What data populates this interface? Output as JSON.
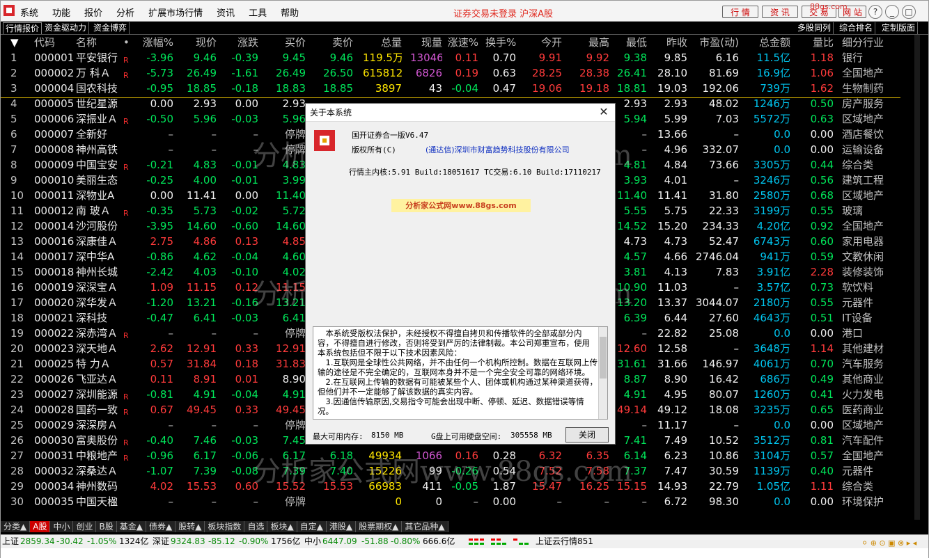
{
  "window": {
    "menus": [
      "系统",
      "功能",
      "报价",
      "分析",
      "扩展市场行情",
      "资讯",
      "工具",
      "帮助"
    ],
    "center_title": "证券交易未登录  沪深A股",
    "buttons": [
      "行 情",
      "资 讯",
      "交 易",
      "网 站"
    ],
    "url_fragment": "88gs.com",
    "controls": [
      "?",
      "_",
      "□",
      "✕"
    ]
  },
  "subtabs": {
    "left": [
      "行情报价",
      "资金驱动力",
      "资金博弈"
    ],
    "right": [
      "多股同列",
      "综合排名",
      "定制版面"
    ]
  },
  "table": {
    "headers": [
      "代码",
      "名称",
      "•",
      "涨幅%",
      "现价",
      "涨跌",
      "买价",
      "卖价",
      "总量",
      "现量",
      "涨速%",
      "换手%",
      "今开",
      "最高",
      "最低",
      "昨收",
      "市盈(动)",
      "总金额",
      "量比",
      "细分行业"
    ],
    "rows": [
      {
        "no": "1",
        "code": "000001",
        "name": "平安银行",
        "mark": "R",
        "chg_pct": "-3.96",
        "price": "9.46",
        "chg": "-0.39",
        "bid": "9.45",
        "ask": "9.46",
        "vol": "119.5万",
        "cur_vol": "13046",
        "speed": "0.11",
        "turnover": "0.70",
        "open": "9.91",
        "high": "9.92",
        "low": "9.38",
        "prev": "9.85",
        "pe": "6.16",
        "amount": "11.5亿",
        "vol_ratio": "1.18",
        "industry": "银行"
      },
      {
        "no": "2",
        "code": "000002",
        "name": "万 科Ａ",
        "mark": "R",
        "chg_pct": "-5.73",
        "price": "26.49",
        "chg": "-1.61",
        "bid": "26.49",
        "ask": "26.50",
        "vol": "615812",
        "cur_vol": "6826",
        "speed": "0.19",
        "turnover": "0.63",
        "open": "28.25",
        "high": "28.38",
        "low": "26.41",
        "prev": "28.10",
        "pe": "81.69",
        "amount": "16.9亿",
        "vol_ratio": "1.06",
        "industry": "全国地产"
      },
      {
        "no": "3",
        "code": "000004",
        "name": "国农科技",
        "mark": "",
        "chg_pct": "-0.95",
        "price": "18.85",
        "chg": "-0.18",
        "bid": "18.83",
        "ask": "18.85",
        "vol": "3897",
        "cur_vol": "43",
        "speed": "-0.04",
        "turnover": "0.47",
        "open": "19.06",
        "high": "19.18",
        "low": "18.81",
        "prev": "19.03",
        "pe": "192.06",
        "amount": "739万",
        "vol_ratio": "1.62",
        "industry": "生物制药"
      },
      {
        "no": "4",
        "code": "000005",
        "name": "世纪星源",
        "mark": "",
        "chg_pct": "0.00",
        "price": "2.93",
        "chg": "0.00",
        "bid": "2.93",
        "ask": "",
        "vol": "",
        "cur_vol": "",
        "speed": "",
        "turnover": "",
        "open": "",
        "high": "",
        "low": "2.93",
        "prev": "2.93",
        "pe": "48.02",
        "amount": "1246万",
        "vol_ratio": "0.50",
        "industry": "房产服务"
      },
      {
        "no": "5",
        "code": "000006",
        "name": "深振业Ａ",
        "mark": "R",
        "chg_pct": "-0.50",
        "price": "5.96",
        "chg": "-0.03",
        "bid": "5.96",
        "ask": "",
        "vol": "",
        "cur_vol": "",
        "speed": "",
        "turnover": "",
        "open": "",
        "high": "",
        "low": "5.94",
        "prev": "5.99",
        "pe": "7.03",
        "amount": "5572万",
        "vol_ratio": "0.63",
        "industry": "区域地产"
      },
      {
        "no": "6",
        "code": "000007",
        "name": "全新好",
        "mark": "",
        "chg_pct": "–",
        "price": "–",
        "chg": "–",
        "bid": "停牌",
        "ask": "",
        "vol": "",
        "cur_vol": "",
        "speed": "",
        "turnover": "",
        "open": "",
        "high": "",
        "low": "–",
        "prev": "13.66",
        "pe": "–",
        "amount": "0.0",
        "vol_ratio": "0.00",
        "industry": "酒店餐饮"
      },
      {
        "no": "7",
        "code": "000008",
        "name": "神州高铁",
        "mark": "",
        "chg_pct": "–",
        "price": "–",
        "chg": "–",
        "bid": "停牌",
        "ask": "",
        "vol": "",
        "cur_vol": "",
        "speed": "",
        "turnover": "",
        "open": "",
        "high": "",
        "low": "–",
        "prev": "4.96",
        "pe": "332.07",
        "amount": "0.0",
        "vol_ratio": "0.00",
        "industry": "运输设备"
      },
      {
        "no": "8",
        "code": "000009",
        "name": "中国宝安",
        "mark": "R",
        "chg_pct": "-0.21",
        "price": "4.83",
        "chg": "-0.01",
        "bid": "4.83",
        "ask": "",
        "vol": "",
        "cur_vol": "",
        "speed": "",
        "turnover": "",
        "open": "",
        "high": "",
        "low": "4.81",
        "prev": "4.84",
        "pe": "73.66",
        "amount": "3305万",
        "vol_ratio": "0.44",
        "industry": "综合类"
      },
      {
        "no": "9",
        "code": "000010",
        "name": "美丽生态",
        "mark": "",
        "chg_pct": "-0.25",
        "price": "4.00",
        "chg": "-0.01",
        "bid": "3.99",
        "ask": "",
        "vol": "",
        "cur_vol": "",
        "speed": "",
        "turnover": "",
        "open": "",
        "high": "",
        "low": "3.93",
        "prev": "4.01",
        "pe": "–",
        "amount": "3246万",
        "vol_ratio": "0.56",
        "industry": "建筑工程"
      },
      {
        "no": "10",
        "code": "000011",
        "name": "深物业A",
        "mark": "",
        "chg_pct": "0.00",
        "price": "11.41",
        "chg": "0.00",
        "bid": "11.40",
        "ask": "",
        "vol": "",
        "cur_vol": "",
        "speed": "",
        "turnover": "",
        "open": "",
        "high": "",
        "low": "11.40",
        "prev": "11.41",
        "pe": "31.80",
        "amount": "2580万",
        "vol_ratio": "0.68",
        "industry": "区域地产"
      },
      {
        "no": "11",
        "code": "000012",
        "name": "南 玻Ａ",
        "mark": "R",
        "chg_pct": "-0.35",
        "price": "5.73",
        "chg": "-0.02",
        "bid": "5.72",
        "ask": "",
        "vol": "",
        "cur_vol": "",
        "speed": "",
        "turnover": "",
        "open": "",
        "high": "",
        "low": "5.55",
        "prev": "5.75",
        "pe": "22.33",
        "amount": "3199万",
        "vol_ratio": "0.55",
        "industry": "玻璃"
      },
      {
        "no": "12",
        "code": "000014",
        "name": "沙河股份",
        "mark": "",
        "chg_pct": "-3.95",
        "price": "14.60",
        "chg": "-0.60",
        "bid": "14.60",
        "ask": "",
        "vol": "",
        "cur_vol": "",
        "speed": "",
        "turnover": "",
        "open": "",
        "high": "",
        "low": "14.52",
        "prev": "15.20",
        "pe": "234.33",
        "amount": "4.20亿",
        "vol_ratio": "0.92",
        "industry": "全国地产"
      },
      {
        "no": "13",
        "code": "000016",
        "name": "深康佳Ａ",
        "mark": "",
        "chg_pct": "2.75",
        "price": "4.86",
        "chg": "0.13",
        "bid": "4.85",
        "ask": "",
        "vol": "",
        "cur_vol": "",
        "speed": "",
        "turnover": "",
        "open": "",
        "high": "",
        "low": "4.73",
        "prev": "4.73",
        "pe": "52.47",
        "amount": "6743万",
        "vol_ratio": "0.60",
        "industry": "家用电器"
      },
      {
        "no": "14",
        "code": "000017",
        "name": "深中华A",
        "mark": "",
        "chg_pct": "-0.86",
        "price": "4.62",
        "chg": "-0.04",
        "bid": "4.60",
        "ask": "",
        "vol": "",
        "cur_vol": "",
        "speed": "",
        "turnover": "",
        "open": "",
        "high": "",
        "low": "4.57",
        "prev": "4.66",
        "pe": "2746.04",
        "amount": "941万",
        "vol_ratio": "0.59",
        "industry": "文教休闲"
      },
      {
        "no": "15",
        "code": "000018",
        "name": "神州长城",
        "mark": "",
        "chg_pct": "-2.42",
        "price": "4.03",
        "chg": "-0.10",
        "bid": "4.02",
        "ask": "",
        "vol": "",
        "cur_vol": "",
        "speed": "",
        "turnover": "",
        "open": "",
        "high": "",
        "low": "3.81",
        "prev": "4.13",
        "pe": "7.83",
        "amount": "3.91亿",
        "vol_ratio": "2.28",
        "industry": "装修装饰"
      },
      {
        "no": "16",
        "code": "000019",
        "name": "深深宝Ａ",
        "mark": "",
        "chg_pct": "1.09",
        "price": "11.15",
        "chg": "0.12",
        "bid": "11.15",
        "ask": "",
        "vol": "",
        "cur_vol": "",
        "speed": "",
        "turnover": "",
        "open": "",
        "high": "",
        "low": "10.90",
        "prev": "11.03",
        "pe": "–",
        "amount": "3.57亿",
        "vol_ratio": "0.73",
        "industry": "软饮料"
      },
      {
        "no": "17",
        "code": "000020",
        "name": "深华发Ａ",
        "mark": "",
        "chg_pct": "-1.20",
        "price": "13.21",
        "chg": "-0.16",
        "bid": "13.21",
        "ask": "",
        "vol": "",
        "cur_vol": "",
        "speed": "",
        "turnover": "",
        "open": "",
        "high": "",
        "low": "13.20",
        "prev": "13.37",
        "pe": "3044.07",
        "amount": "2180万",
        "vol_ratio": "0.55",
        "industry": "元器件"
      },
      {
        "no": "18",
        "code": "000021",
        "name": "深科技",
        "mark": "",
        "chg_pct": "-0.47",
        "price": "6.41",
        "chg": "-0.03",
        "bid": "6.41",
        "ask": "",
        "vol": "",
        "cur_vol": "",
        "speed": "",
        "turnover": "",
        "open": "",
        "high": "",
        "low": "6.39",
        "prev": "6.44",
        "pe": "27.60",
        "amount": "4643万",
        "vol_ratio": "0.51",
        "industry": "IT设备"
      },
      {
        "no": "19",
        "code": "000022",
        "name": "深赤湾Ａ",
        "mark": "R",
        "chg_pct": "–",
        "price": "–",
        "chg": "–",
        "bid": "停牌",
        "ask": "",
        "vol": "",
        "cur_vol": "",
        "speed": "",
        "turnover": "",
        "open": "",
        "high": "",
        "low": "–",
        "prev": "22.82",
        "pe": "25.08",
        "amount": "0.0",
        "vol_ratio": "0.00",
        "industry": "港口"
      },
      {
        "no": "20",
        "code": "000023",
        "name": "深天地Ａ",
        "mark": "",
        "chg_pct": "2.62",
        "price": "12.91",
        "chg": "0.33",
        "bid": "12.91",
        "ask": "",
        "vol": "",
        "cur_vol": "",
        "speed": "",
        "turnover": "",
        "open": "",
        "high": "",
        "low": "12.60",
        "prev": "12.58",
        "pe": "–",
        "amount": "3648万",
        "vol_ratio": "1.14",
        "industry": "其他建材"
      },
      {
        "no": "21",
        "code": "000025",
        "name": "特 力Ａ",
        "mark": "",
        "chg_pct": "0.57",
        "price": "31.84",
        "chg": "0.18",
        "bid": "31.83",
        "ask": "",
        "vol": "",
        "cur_vol": "",
        "speed": "",
        "turnover": "",
        "open": "",
        "high": "",
        "low": "31.61",
        "prev": "31.66",
        "pe": "146.97",
        "amount": "4061万",
        "vol_ratio": "0.70",
        "industry": "汽车服务"
      },
      {
        "no": "22",
        "code": "000026",
        "name": "飞亚达Ａ",
        "mark": "",
        "chg_pct": "0.11",
        "price": "8.91",
        "chg": "0.01",
        "bid": "8.90",
        "ask": "",
        "vol": "",
        "cur_vol": "",
        "speed": "",
        "turnover": "",
        "open": "",
        "high": "",
        "low": "8.87",
        "prev": "8.90",
        "pe": "16.42",
        "amount": "686万",
        "vol_ratio": "0.49",
        "industry": "其他商业"
      },
      {
        "no": "23",
        "code": "000027",
        "name": "深圳能源",
        "mark": "R",
        "chg_pct": "-0.81",
        "price": "4.91",
        "chg": "-0.04",
        "bid": "4.91",
        "ask": "",
        "vol": "",
        "cur_vol": "",
        "speed": "",
        "turnover": "",
        "open": "",
        "high": "",
        "low": "4.91",
        "prev": "4.95",
        "pe": "80.07",
        "amount": "1260万",
        "vol_ratio": "0.41",
        "industry": "火力发电"
      },
      {
        "no": "24",
        "code": "000028",
        "name": "国药一致",
        "mark": "R",
        "chg_pct": "0.67",
        "price": "49.45",
        "chg": "0.33",
        "bid": "49.45",
        "ask": "",
        "vol": "",
        "cur_vol": "",
        "speed": "",
        "turnover": "",
        "open": "",
        "high": "",
        "low": "49.14",
        "prev": "49.12",
        "pe": "18.08",
        "amount": "3235万",
        "vol_ratio": "0.65",
        "industry": "医药商业"
      },
      {
        "no": "25",
        "code": "000029",
        "name": "深深房Ａ",
        "mark": "",
        "chg_pct": "–",
        "price": "–",
        "chg": "–",
        "bid": "停牌",
        "ask": "",
        "vol": "",
        "cur_vol": "",
        "speed": "",
        "turnover": "",
        "open": "",
        "high": "",
        "low": "–",
        "prev": "11.17",
        "pe": "–",
        "amount": "0.0",
        "vol_ratio": "0.00",
        "industry": "区域地产"
      },
      {
        "no": "26",
        "code": "000030",
        "name": "富奥股份",
        "mark": "R",
        "chg_pct": "-0.40",
        "price": "7.46",
        "chg": "-0.03",
        "bid": "7.45",
        "ask": "",
        "vol": "",
        "cur_vol": "",
        "speed": "",
        "turnover": "",
        "open": "",
        "high": "",
        "low": "7.41",
        "prev": "7.49",
        "pe": "10.52",
        "amount": "3512万",
        "vol_ratio": "0.81",
        "industry": "汽车配件"
      },
      {
        "no": "27",
        "code": "000031",
        "name": "中粮地产",
        "mark": "R",
        "chg_pct": "-0.96",
        "price": "6.17",
        "chg": "-0.06",
        "bid": "6.17",
        "ask": "6.18",
        "vol": "49934",
        "cur_vol": "1066",
        "speed": "0.16",
        "turnover": "0.28",
        "open": "6.32",
        "high": "6.35",
        "low": "6.14",
        "prev": "6.23",
        "pe": "10.86",
        "amount": "3104万",
        "vol_ratio": "0.57",
        "industry": "全国地产"
      },
      {
        "no": "28",
        "code": "000032",
        "name": "深桑达Ａ",
        "mark": "",
        "chg_pct": "-1.07",
        "price": "7.39",
        "chg": "-0.08",
        "bid": "7.39",
        "ask": "7.40",
        "vol": "15226",
        "cur_vol": "99",
        "speed": "-0.26",
        "turnover": "0.54",
        "open": "7.52",
        "high": "7.58",
        "low": "7.37",
        "prev": "7.47",
        "pe": "30.59",
        "amount": "1139万",
        "vol_ratio": "0.40",
        "industry": "元器件"
      },
      {
        "no": "29",
        "code": "000034",
        "name": "神州数码",
        "mark": "",
        "chg_pct": "4.02",
        "price": "15.53",
        "chg": "0.60",
        "bid": "15.52",
        "ask": "15.53",
        "vol": "66983",
        "cur_vol": "411",
        "speed": "-0.05",
        "turnover": "1.87",
        "open": "15.47",
        "high": "16.25",
        "low": "15.15",
        "prev": "14.93",
        "pe": "22.79",
        "amount": "1.05亿",
        "vol_ratio": "1.11",
        "industry": "综合类"
      },
      {
        "no": "30",
        "code": "000035",
        "name": "中国天楹",
        "mark": "",
        "chg_pct": "–",
        "price": "–",
        "chg": "–",
        "bid": "停牌",
        "ask": "",
        "vol": "0",
        "cur_vol": "0",
        "speed": "–",
        "turnover": "0.00",
        "open": "–",
        "high": "–",
        "low": "–",
        "prev": "6.72",
        "pe": "98.30",
        "amount": "0.0",
        "vol_ratio": "0.00",
        "industry": "环境保护"
      }
    ]
  },
  "watermarks": [
    "分析家公式网www.88gs.com",
    "分析家公式网www.88gs.com",
    "分析家公式网www.88gs.com"
  ],
  "bottom_tabs": [
    "分类▲",
    "A股",
    "中小",
    "创业",
    "B股",
    "基金▲",
    "债券▲",
    "股转▲",
    "板块指数",
    "自选",
    "板块▲",
    "自定▲",
    "港股▲",
    "股票期权▲",
    "其它品种▲"
  ],
  "statusbar": {
    "sh_label": "上证",
    "sh_val": "2859.34",
    "sh_chg": "-30.42",
    "sh_pct": "-1.05%",
    "sh_amt": "1324亿",
    "sz_label": "深证",
    "sz_val": "9324.83",
    "sz_chg": "-85.12",
    "sz_pct": "-0.90%",
    "sz_amt": "1756亿",
    "zx_label": "中小",
    "zx_val": "6447.09",
    "zx_chg": "-51.88",
    "zx_pct": "-0.80%",
    "zx_amt": "666.6亿",
    "cloud": "上证云行情851"
  },
  "dialog": {
    "title": "关于本系统",
    "product": "国开证券合一版V6.47",
    "copyright": "版权所有(C)",
    "company": "(通达信)深圳市财富趋势科技股份有限公司",
    "build": "行情主内核:5.91 Build:18051617 TC交易:6.10 Build:17110217",
    "watermark_box": "分析家公式网www.88gs.com",
    "legal_text": "本系统受版权法保护，未经授权不得擅自拷贝和传播软件的全部或部分内容，不得擅自进行修改，否则将受到严厉的法律制裁。本公司郑重宣布，使用本系统包括但不限于以下技术因素风险：\n1.互联网是全球性公共网络，并不由任何一个机构所控制。数据在互联网上传输的途径是不完全确定的，互联网本身并不是一个完全安全可靠的网络环境。\n2.在互联网上传输的数据有可能被某些个人、团体或机构通过某种渠道获得，但他们并不一定能够了解该数据的真实内容。\n3.因通信传输原因,交易指令可能会出现中断、停顿、延迟、数据错误等情况。",
    "mem_label": "最大可用内存:",
    "mem_val": "8150 MB",
    "disk_label": "G盘上可用硬盘空间:",
    "disk_val": "305558 MB",
    "close_label": "关闭"
  },
  "colors": {
    "up": "#ff3b3b",
    "down": "#00e65a",
    "amount": "#00c6f0",
    "volume": "#ffe600",
    "cur_vol": "#d257d2"
  }
}
